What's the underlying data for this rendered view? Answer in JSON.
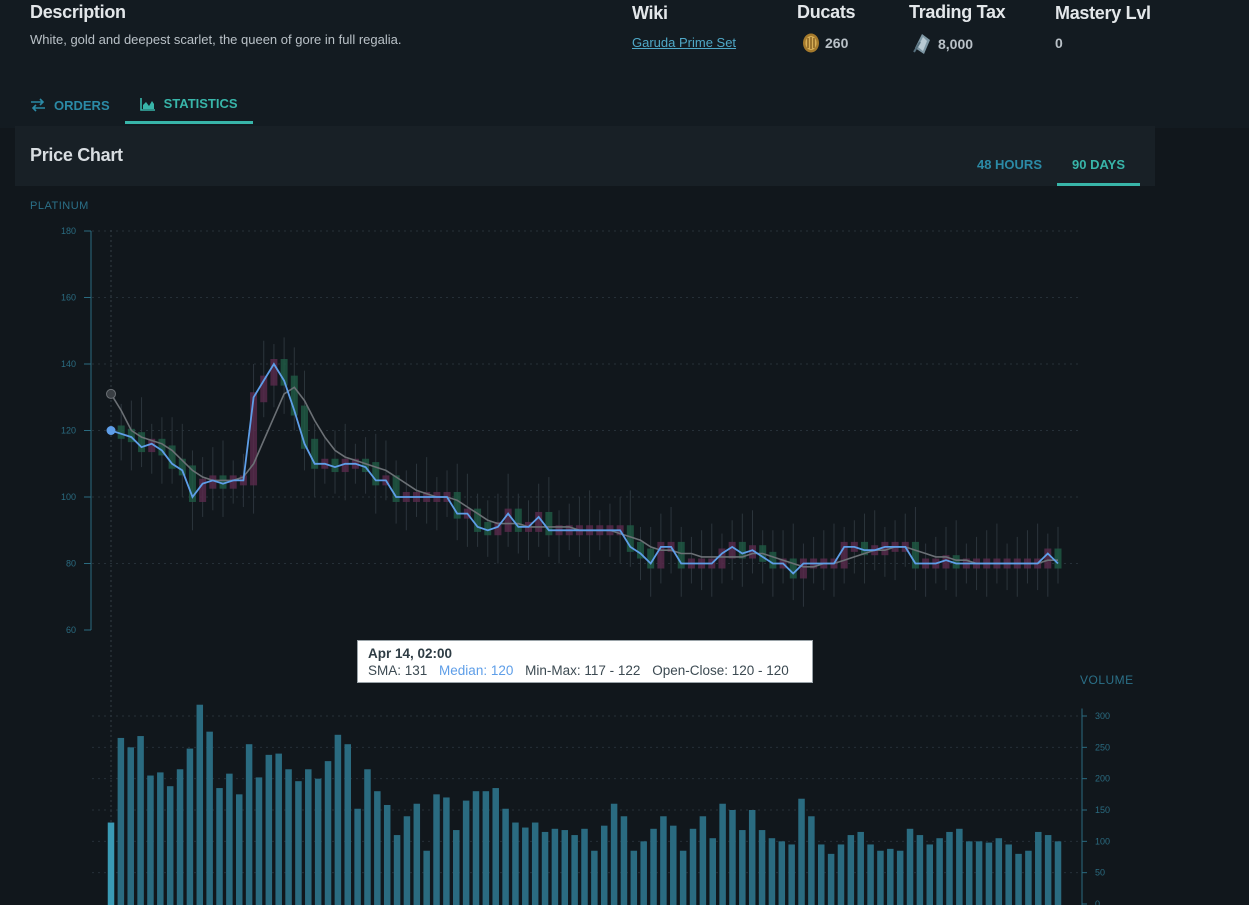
{
  "header": {
    "description": {
      "title": "Description",
      "text": "White, gold and deepest scarlet, the queen of gore in full regalia."
    },
    "wiki": {
      "title": "Wiki",
      "link": "Garuda Prime Set"
    },
    "ducats": {
      "title": "Ducats",
      "value": "260",
      "icon": "ducat-icon"
    },
    "trading_tax": {
      "title": "Trading Tax",
      "value": "8,000",
      "icon": "credits-icon"
    },
    "mastery": {
      "title": "Mastery Lvl",
      "value": "0"
    }
  },
  "tabs": [
    {
      "label": "ORDERS",
      "icon": "swap-arrows-icon",
      "active": false
    },
    {
      "label": "STATISTICS",
      "icon": "area-chart-icon",
      "active": true
    }
  ],
  "price_chart": {
    "title": "Price Chart",
    "ranges": [
      {
        "label": "48 HOURS",
        "active": false
      },
      {
        "label": "90 DAYS",
        "active": true
      }
    ]
  },
  "tooltip": {
    "date": "Apr 14, 02:00",
    "sma": "SMA: 131",
    "median": "Median: 120",
    "minmax": "Min-Max: 117 - 122",
    "openclose": "Open-Close: 120 - 120"
  },
  "colors": {
    "median_line": "#5e9ee8",
    "sma_line": "#6b7075",
    "volume_bar": "#2a6b80",
    "up_candle": "#1f5b45",
    "down_candle": "#5a2a4c",
    "accent": "#38b5a9"
  },
  "chart_data": {
    "type": "line",
    "price_axis": {
      "label": "PLATINUM",
      "ylim": [
        60,
        180
      ],
      "ticks": [
        60,
        80,
        100,
        120,
        140,
        160,
        180
      ]
    },
    "volume_axis": {
      "label": "VOLUME",
      "ylim": [
        0,
        320
      ],
      "ticks": [
        0,
        50,
        100,
        150,
        200,
        250,
        300
      ]
    },
    "series": [
      {
        "name": "Median",
        "values": [
          120,
          119,
          118,
          115,
          116,
          114,
          110,
          108,
          100,
          104,
          105,
          104,
          105,
          105,
          130,
          135,
          140,
          135,
          126,
          116,
          110,
          110,
          109,
          110,
          110,
          109,
          105,
          105,
          100,
          100,
          100,
          100,
          100,
          100,
          95,
          95,
          91,
          90,
          91,
          95,
          91,
          91,
          94,
          90,
          90,
          90,
          90,
          90,
          90,
          90,
          90,
          85,
          83,
          80,
          85,
          85,
          80,
          80,
          80,
          80,
          83,
          85,
          83,
          84,
          82,
          80,
          80,
          77,
          80,
          80,
          80,
          80,
          85,
          85,
          84,
          84,
          85,
          85,
          85,
          80,
          80,
          80,
          81,
          80,
          80,
          80,
          80,
          80,
          80,
          80,
          80,
          80,
          83,
          80
        ]
      },
      {
        "name": "SMA",
        "values": [
          131,
          126,
          120,
          118,
          117,
          116,
          114,
          111,
          108,
          106,
          105,
          105,
          105,
          106,
          110,
          117,
          124,
          131,
          133,
          129,
          123,
          118,
          114,
          112,
          111,
          110,
          109,
          108,
          106,
          104,
          102,
          101,
          100,
          100,
          99,
          97,
          95,
          93,
          92,
          92,
          92,
          91,
          91,
          91,
          91,
          91,
          90,
          90,
          90,
          90,
          89,
          88,
          87,
          85,
          84,
          84,
          83,
          83,
          82,
          82,
          82,
          82,
          82,
          83,
          83,
          82,
          81,
          80,
          79,
          79,
          80,
          80,
          81,
          82,
          83,
          84,
          84,
          85,
          85,
          84,
          83,
          82,
          82,
          81,
          81,
          80,
          80,
          80,
          80,
          80,
          80,
          80,
          81,
          81
        ]
      },
      {
        "name": "Volume",
        "values": [
          130,
          265,
          250,
          268,
          205,
          210,
          188,
          215,
          248,
          318,
          275,
          185,
          208,
          175,
          255,
          202,
          238,
          240,
          215,
          196,
          215,
          200,
          228,
          270,
          255,
          152,
          215,
          180,
          158,
          110,
          140,
          160,
          85,
          175,
          170,
          118,
          165,
          180,
          180,
          185,
          152,
          130,
          122,
          130,
          115,
          120,
          118,
          110,
          120,
          85,
          125,
          160,
          140,
          85,
          100,
          120,
          140,
          125,
          85,
          120,
          140,
          105,
          160,
          150,
          118,
          150,
          118,
          105,
          100,
          95,
          168,
          140,
          95,
          80,
          95,
          110,
          115,
          95,
          85,
          88,
          85,
          120,
          110,
          95,
          105,
          115,
          120,
          100,
          100,
          98,
          105,
          95,
          80,
          85,
          115,
          110,
          100
        ]
      }
    ]
  }
}
